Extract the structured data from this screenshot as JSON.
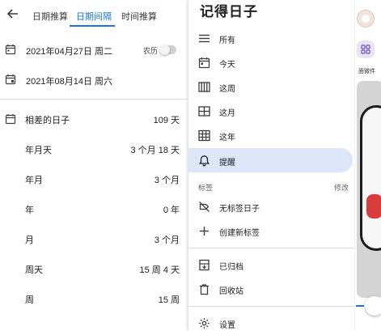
{
  "tabs": [
    {
      "label": "日期推算"
    },
    {
      "label": "日期间隔"
    },
    {
      "label": "时间推算"
    }
  ],
  "active_tab": "日期间隔",
  "dates": {
    "start": "2021年04月27日 周二",
    "end": "2021年08月14日 周六",
    "lunar_label": "农历",
    "lunar_enabled": false
  },
  "results": [
    {
      "label": "相差的日子",
      "value": "109 天"
    },
    {
      "label": "年月天",
      "value": "3 个月 18 天"
    },
    {
      "label": "年月",
      "value": "3 个月"
    },
    {
      "label": "年",
      "value": "0 年"
    },
    {
      "label": "月",
      "value": "3 个月"
    },
    {
      "label": "周天",
      "value": "15 周 4 天"
    },
    {
      "label": "周",
      "value": "15 周"
    }
  ],
  "drawer": {
    "title": "记得日子",
    "items": [
      {
        "label": "所有",
        "icon": "list-icon"
      },
      {
        "label": "今天",
        "icon": "calendar-today-icon"
      },
      {
        "label": "这周",
        "icon": "view-week-icon"
      },
      {
        "label": "这月",
        "icon": "view-month-icon"
      },
      {
        "label": "这年",
        "icon": "view-year-icon"
      },
      {
        "label": "提醒",
        "icon": "bell-icon",
        "active": true
      }
    ],
    "tags_section": {
      "label": "标签",
      "action": "修改"
    },
    "tag_items": [
      {
        "label": "无标签日子",
        "icon": "label-off-icon"
      },
      {
        "label": "创建新标签",
        "icon": "plus-icon"
      }
    ],
    "archive_items": [
      {
        "label": "已归档",
        "icon": "archive-icon"
      },
      {
        "label": "回收站",
        "icon": "trash-icon"
      }
    ],
    "settings": {
      "label": "设置",
      "icon": "gear-icon"
    }
  },
  "peek": {
    "widget_label": "面微件"
  },
  "colors": {
    "accent": "#1a73e8",
    "active_bg": "#dce6f8"
  }
}
